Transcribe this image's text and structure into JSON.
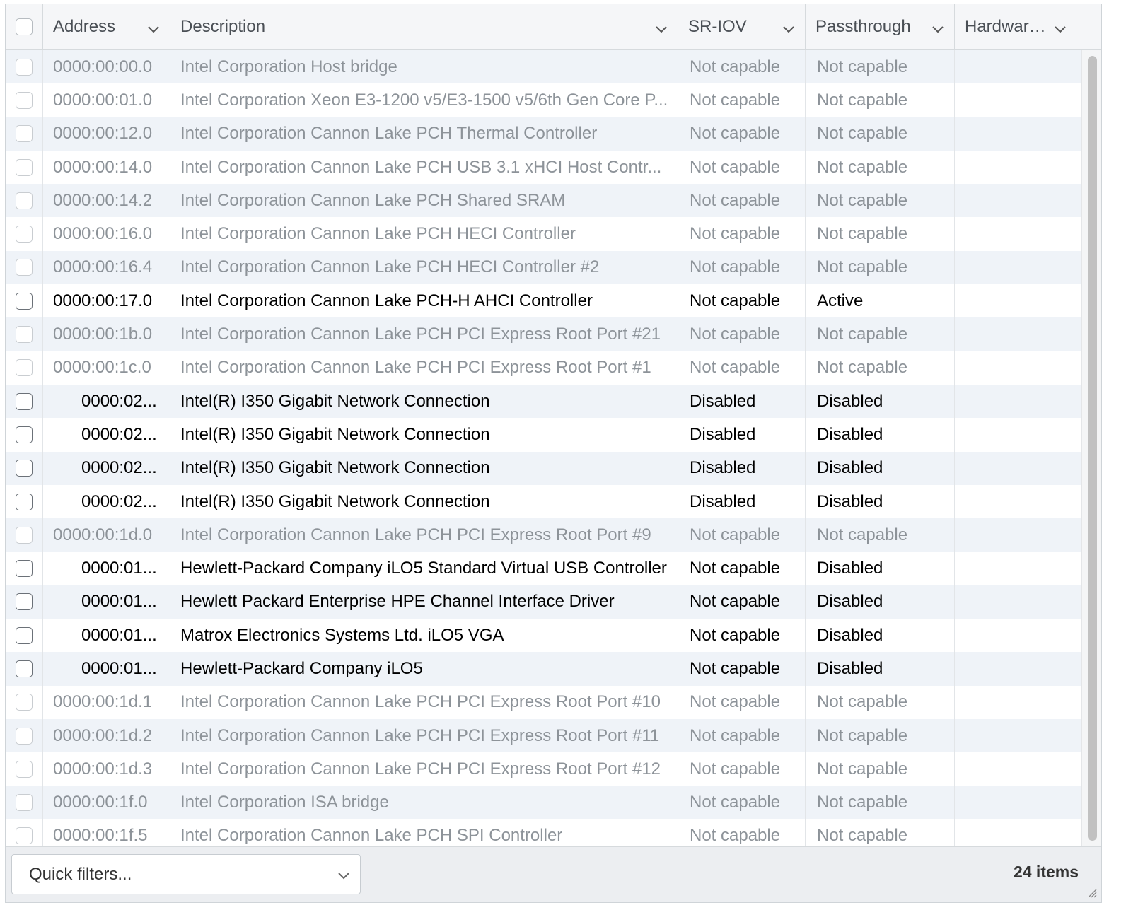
{
  "header": {
    "columns": [
      "Address",
      "Description",
      "SR-IOV",
      "Passthrough",
      "Hardware ..."
    ]
  },
  "rows": [
    {
      "address": "0000:00:00.0",
      "description": "Intel Corporation Host bridge",
      "sriov": "Not capable",
      "passthrough": "Not capable",
      "hardware": "",
      "disabled": true,
      "child": false
    },
    {
      "address": "0000:00:01.0",
      "description": "Intel Corporation Xeon E3-1200 v5/E3-1500 v5/6th Gen Core P...",
      "sriov": "Not capable",
      "passthrough": "Not capable",
      "hardware": "",
      "disabled": true,
      "child": false
    },
    {
      "address": "0000:00:12.0",
      "description": "Intel Corporation Cannon Lake PCH Thermal Controller",
      "sriov": "Not capable",
      "passthrough": "Not capable",
      "hardware": "",
      "disabled": true,
      "child": false
    },
    {
      "address": "0000:00:14.0",
      "description": "Intel Corporation Cannon Lake PCH USB 3.1 xHCI Host Contr...",
      "sriov": "Not capable",
      "passthrough": "Not capable",
      "hardware": "",
      "disabled": true,
      "child": false
    },
    {
      "address": "0000:00:14.2",
      "description": "Intel Corporation Cannon Lake PCH Shared SRAM",
      "sriov": "Not capable",
      "passthrough": "Not capable",
      "hardware": "",
      "disabled": true,
      "child": false
    },
    {
      "address": "0000:00:16.0",
      "description": "Intel Corporation Cannon Lake PCH HECI Controller",
      "sriov": "Not capable",
      "passthrough": "Not capable",
      "hardware": "",
      "disabled": true,
      "child": false
    },
    {
      "address": "0000:00:16.4",
      "description": "Intel Corporation Cannon Lake PCH HECI Controller #2",
      "sriov": "Not capable",
      "passthrough": "Not capable",
      "hardware": "",
      "disabled": true,
      "child": false
    },
    {
      "address": "0000:00:17.0",
      "description": "Intel Corporation Cannon Lake PCH-H AHCI Controller",
      "sriov": "Not capable",
      "passthrough": "Active",
      "hardware": "",
      "disabled": false,
      "child": false
    },
    {
      "address": "0000:00:1b.0",
      "description": "Intel Corporation Cannon Lake PCH PCI Express Root Port #21",
      "sriov": "Not capable",
      "passthrough": "Not capable",
      "hardware": "",
      "disabled": true,
      "child": false
    },
    {
      "address": "0000:00:1c.0",
      "description": "Intel Corporation Cannon Lake PCH PCI Express Root Port #1",
      "sriov": "Not capable",
      "passthrough": "Not capable",
      "hardware": "",
      "disabled": true,
      "child": false
    },
    {
      "address": "0000:02...",
      "description": "Intel(R) I350 Gigabit Network Connection",
      "sriov": "Disabled",
      "passthrough": "Disabled",
      "hardware": "",
      "disabled": false,
      "child": true
    },
    {
      "address": "0000:02...",
      "description": "Intel(R) I350 Gigabit Network Connection",
      "sriov": "Disabled",
      "passthrough": "Disabled",
      "hardware": "",
      "disabled": false,
      "child": true
    },
    {
      "address": "0000:02...",
      "description": "Intel(R) I350 Gigabit Network Connection",
      "sriov": "Disabled",
      "passthrough": "Disabled",
      "hardware": "",
      "disabled": false,
      "child": true
    },
    {
      "address": "0000:02...",
      "description": "Intel(R) I350 Gigabit Network Connection",
      "sriov": "Disabled",
      "passthrough": "Disabled",
      "hardware": "",
      "disabled": false,
      "child": true
    },
    {
      "address": "0000:00:1d.0",
      "description": "Intel Corporation Cannon Lake PCH PCI Express Root Port #9",
      "sriov": "Not capable",
      "passthrough": "Not capable",
      "hardware": "",
      "disabled": true,
      "child": false
    },
    {
      "address": "0000:01...",
      "description": "Hewlett-Packard Company iLO5 Standard Virtual USB Controller",
      "sriov": "Not capable",
      "passthrough": "Disabled",
      "hardware": "",
      "disabled": false,
      "child": true
    },
    {
      "address": "0000:01...",
      "description": "Hewlett Packard Enterprise HPE Channel Interface Driver",
      "sriov": "Not capable",
      "passthrough": "Disabled",
      "hardware": "",
      "disabled": false,
      "child": true
    },
    {
      "address": "0000:01...",
      "description": "Matrox Electronics Systems Ltd. iLO5 VGA",
      "sriov": "Not capable",
      "passthrough": "Disabled",
      "hardware": "",
      "disabled": false,
      "child": true
    },
    {
      "address": "0000:01...",
      "description": "Hewlett-Packard Company iLO5",
      "sriov": "Not capable",
      "passthrough": "Disabled",
      "hardware": "",
      "disabled": false,
      "child": true
    },
    {
      "address": "0000:00:1d.1",
      "description": "Intel Corporation Cannon Lake PCH PCI Express Root Port #10",
      "sriov": "Not capable",
      "passthrough": "Not capable",
      "hardware": "",
      "disabled": true,
      "child": false
    },
    {
      "address": "0000:00:1d.2",
      "description": "Intel Corporation Cannon Lake PCH PCI Express Root Port #11",
      "sriov": "Not capable",
      "passthrough": "Not capable",
      "hardware": "",
      "disabled": true,
      "child": false
    },
    {
      "address": "0000:00:1d.3",
      "description": "Intel Corporation Cannon Lake PCH PCI Express Root Port #12",
      "sriov": "Not capable",
      "passthrough": "Not capable",
      "hardware": "",
      "disabled": true,
      "child": false
    },
    {
      "address": "0000:00:1f.0",
      "description": "Intel Corporation ISA bridge",
      "sriov": "Not capable",
      "passthrough": "Not capable",
      "hardware": "",
      "disabled": true,
      "child": false
    },
    {
      "address": "0000:00:1f.5",
      "description": "Intel Corporation Cannon Lake PCH SPI Controller",
      "sriov": "Not capable",
      "passthrough": "Not capable",
      "hardware": "",
      "disabled": true,
      "child": false
    }
  ],
  "footer": {
    "quick_filters_label": "Quick filters...",
    "item_count": "24 items"
  },
  "icons": {
    "sort": "chevron-down-icon",
    "dropdown": "chevron-down-icon",
    "resize": "resize-grip-icon"
  },
  "colors": {
    "disabled_text": "#8d9399",
    "alt_row": "#eff3f8",
    "header_bg": "#f5f6f8"
  }
}
